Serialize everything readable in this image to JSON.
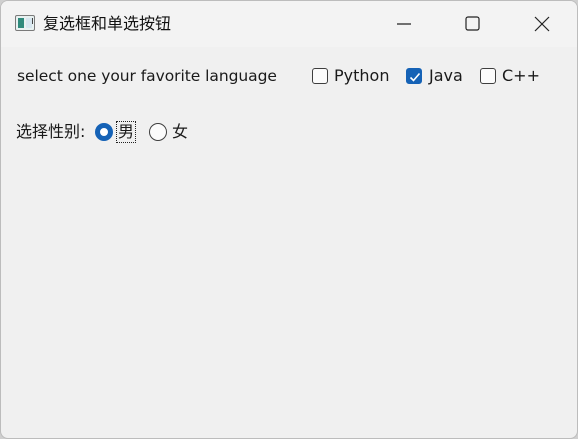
{
  "window": {
    "title": "复选框和单选按钮",
    "icon": "app-window-icon",
    "controls": [
      "minimize-icon",
      "maximize-icon",
      "close-icon"
    ]
  },
  "language_group": {
    "label": "select one your favorite language",
    "options": [
      {
        "label": "Python",
        "checked": false
      },
      {
        "label": "Java",
        "checked": true
      },
      {
        "label": "C++",
        "checked": false
      }
    ]
  },
  "gender_group": {
    "label": "选择性别:",
    "options": [
      {
        "label": "男",
        "selected": true
      },
      {
        "label": "女",
        "selected": false
      }
    ]
  },
  "colors": {
    "accent": "#1562b6",
    "window_bg": "#f0f0f0",
    "titlebar_bg": "#f3f3f3",
    "text": "#1a1a1a"
  }
}
